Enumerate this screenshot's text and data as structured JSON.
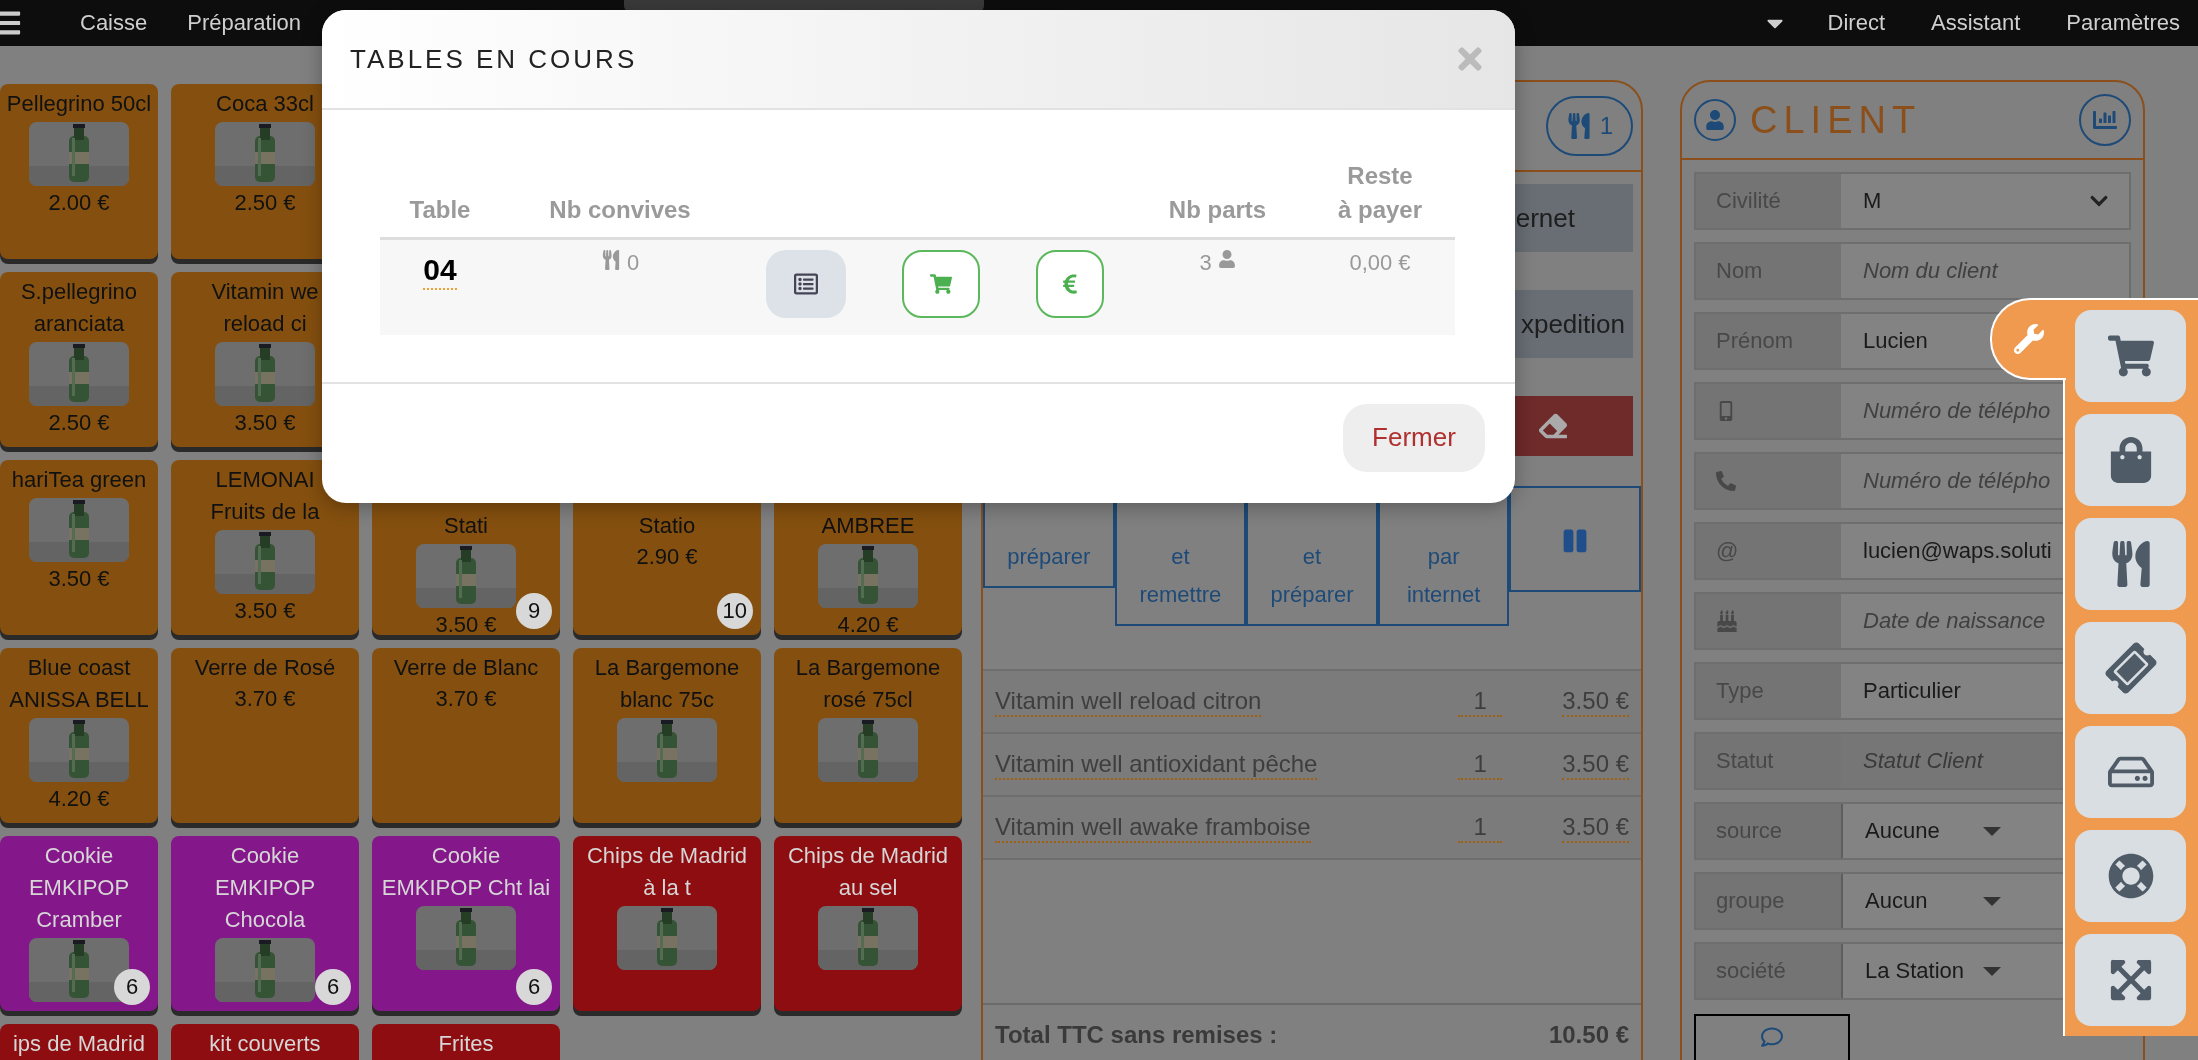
{
  "nav": {
    "left_items": [
      "Caisse",
      "Préparation"
    ],
    "right_items": [
      "Direct",
      "Assistant",
      "Paramètres"
    ]
  },
  "products": [
    {
      "tiles": [
        {
          "name": "Pellegrino 50cl",
          "photo": true,
          "price": "2.00 €",
          "color": "#85500f"
        },
        {
          "name": "Coca 33cl",
          "photo": true,
          "price": "2.50 €",
          "color": "#85500f"
        }
      ]
    },
    {
      "tiles": [
        {
          "name": "S.pellegrino\naranciata",
          "photo": true,
          "price": "2.50 €",
          "color": "#85500f"
        },
        {
          "name": "Vitamin we\nreload ci",
          "photo": true,
          "price": "3.50 €",
          "color": "#85500f"
        }
      ]
    },
    {
      "tiles": [
        {
          "name": "hariTea green",
          "photo": true,
          "price": "3.50 €",
          "color": "#85500f"
        },
        {
          "name": "LEMONAI\nFruits de la",
          "photo": true,
          "price": "3.50 €",
          "color": "#85500f"
        },
        {
          "kind": "covered",
          "name": "Stati",
          "photo": true,
          "price": "3.50 €",
          "badge": "9",
          "color": "#85500f"
        },
        {
          "kind": "covered",
          "name": "Statio",
          "photo": false,
          "price": "2.90 €",
          "badge": "10",
          "color": "#85500f"
        },
        {
          "kind": "covered",
          "name": "AMBREE",
          "photo": true,
          "price": "4.20 €",
          "color": "#85500f"
        }
      ]
    },
    {
      "tiles": [
        {
          "name": "Blue coast\nANISSA BELL",
          "photo": true,
          "price": "4.20 €",
          "color": "#85500f"
        },
        {
          "name": "Verre de Rosé",
          "photo": false,
          "price": "3.70 €",
          "color": "#85500f"
        },
        {
          "name": "Verre de Blanc",
          "photo": false,
          "price": "3.70 €",
          "color": "#85500f"
        },
        {
          "name": "La Bargemone\nblanc 75c",
          "photo": true,
          "color": "#85500f"
        },
        {
          "name": "La Bargemone\nrosé 75cl",
          "photo": true,
          "color": "#85500f"
        }
      ]
    },
    {
      "tiles": [
        {
          "name": "Cookie\nEMKIPOP\nCramber",
          "photo": true,
          "badge": "6",
          "color": "#84178a"
        },
        {
          "name": "Cookie\nEMKIPOP\nChocola",
          "photo": true,
          "badge": "6",
          "color": "#84178a"
        },
        {
          "name": "Cookie\nEMKIPOP Cht lai",
          "photo": true,
          "badge": "6",
          "color": "#84178a"
        },
        {
          "name": "Chips de Madrid\nà la t",
          "photo": true,
          "color": "#8e0d10"
        },
        {
          "name": "Chips de Madrid\nau sel",
          "photo": true,
          "color": "#8e0d10"
        }
      ]
    },
    {
      "tiles": [
        {
          "name": "ips de Madrid",
          "photo": false,
          "color": "#8e0d10"
        },
        {
          "name": "kit couverts",
          "photo": false,
          "color": "#8e0d10"
        },
        {
          "name": "Frites",
          "photo": false,
          "color": "#8e0d10"
        }
      ]
    }
  ],
  "order": {
    "covers": "1",
    "channel_buttons": [
      "ernet",
      "xpedition"
    ],
    "payment_buttons": [
      {
        "kind": "label",
        "label": "préparer"
      },
      {
        "kind": "label",
        "label": "et\nremettre"
      },
      {
        "kind": "label",
        "label": "et\npréparer"
      },
      {
        "kind": "label",
        "label": "par\ninternet"
      },
      {
        "kind": "pause"
      }
    ],
    "lines": [
      {
        "name": "Vitamin well reload citron",
        "qty": "1",
        "price": "3.50 €"
      },
      {
        "name": "Vitamin well antioxidant pêche",
        "qty": "1",
        "price": "3.50 €"
      },
      {
        "name": "Vitamin well awake framboise",
        "qty": "1",
        "price": "3.50 €"
      }
    ],
    "total": {
      "label": "Total TTC sans remises :",
      "value": "10.50 €"
    }
  },
  "client": {
    "title": "CLIENT",
    "fields": [
      {
        "label": "Civilité",
        "kind": "select",
        "value": "M"
      },
      {
        "label": "Nom",
        "kind": "input",
        "placeholder": "Nom du client"
      },
      {
        "label": "Prénom",
        "kind": "input",
        "value": "Lucien"
      },
      {
        "kind": "mobile",
        "placeholder": "Numéro de télépho"
      },
      {
        "kind": "phone",
        "placeholder": "Numéro de télépho"
      },
      {
        "label": "@",
        "kind": "input",
        "value": "lucien@waps.soluti"
      },
      {
        "kind": "birthdate",
        "placeholder": "Date de naissance"
      },
      {
        "label": "Type",
        "kind": "input",
        "value": "Particulier"
      },
      {
        "label": "Statut",
        "kind": "readonly",
        "placeholder": "Statut Client"
      },
      {
        "label": "source",
        "kind": "dropdown",
        "value": "Aucune"
      },
      {
        "label": "groupe",
        "kind": "dropdown",
        "value": "Aucun"
      },
      {
        "label": "société",
        "kind": "dropdown",
        "value": "La Station"
      }
    ]
  },
  "modal": {
    "title": "TABLES EN COURS",
    "columns": [
      {
        "label": "Table"
      },
      {
        "label": "Nb convives"
      },
      {},
      {},
      {},
      {
        "label": "Nb parts"
      },
      {
        "label": "Reste\nà payer"
      }
    ],
    "rows": [
      {
        "cells": [
          {
            "kind": "table",
            "text": "04"
          },
          {
            "kind": "covers",
            "text": "0"
          },
          {
            "kind": "view"
          },
          {
            "kind": "cart"
          },
          {
            "kind": "pay"
          },
          {
            "kind": "parts",
            "text": "3"
          },
          {
            "kind": "amount",
            "text": "0,00 €"
          }
        ]
      }
    ],
    "close_button": "Fermer"
  }
}
